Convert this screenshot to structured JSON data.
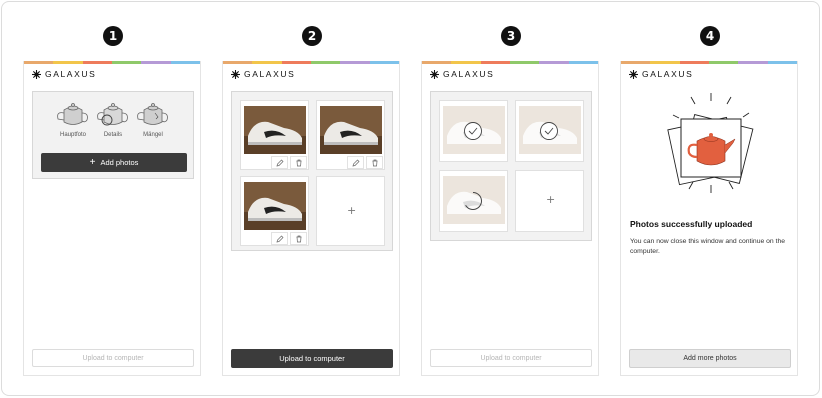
{
  "brand": {
    "name": "GALAXUS"
  },
  "colors": {
    "rainbow": [
      "#e8a86b",
      "#f2c54a",
      "#ee7b5b",
      "#8fc96a",
      "#b59ad6",
      "#7cc1ea"
    ],
    "button_dark": "#3b3b3b",
    "teapot_fill": "#e2603f"
  },
  "steps": [
    {
      "number": "1"
    },
    {
      "number": "2"
    },
    {
      "number": "3"
    },
    {
      "number": "4"
    }
  ],
  "step1": {
    "teapot_labels": [
      "Hauptfoto",
      "Details",
      "Mängel"
    ],
    "add_photos_label": "Add photos",
    "upload_label": "Upload to computer"
  },
  "step2": {
    "upload_label": "Upload to computer"
  },
  "step3": {
    "upload_label": "Upload to computer"
  },
  "step4": {
    "title": "Photos successfully uploaded",
    "text": "You can now close this window and continue on the computer.",
    "add_more_label": "Add more photos"
  },
  "icons": {
    "plus": "+",
    "edit": "pencil-icon",
    "delete": "trash-icon",
    "check": "check-icon",
    "spinner": "spinner-icon"
  }
}
